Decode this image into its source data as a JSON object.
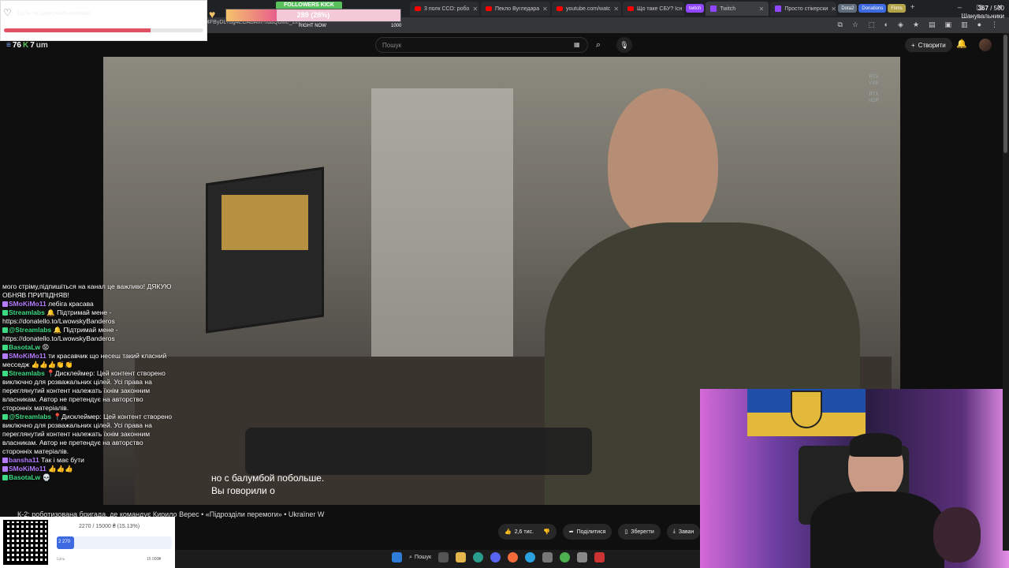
{
  "browser": {
    "url": "4FByDLTbg4ECABAIK-ndaQBMe_zx7",
    "tabs": [
      {
        "label": "3 полк ССО: робо",
        "icon": "youtube"
      },
      {
        "label": "Пекло Вугледара",
        "icon": "youtube"
      },
      {
        "label": "youtube.com/watc",
        "icon": "youtube"
      },
      {
        "label": "Що таке СБУ? Існ",
        "icon": "youtube"
      },
      {
        "label": "Twitch",
        "icon": "twitch"
      },
      {
        "label": "Просто стікерски",
        "icon": "twitch"
      }
    ],
    "twitch_chip": "twitch",
    "bookmark_chips": [
      "Dota2",
      "Donations",
      "Films"
    ],
    "window_controls": [
      "–",
      "▢",
      "✕"
    ]
  },
  "overlay_stats": {
    "left_value": "76",
    "mid_value": "7",
    "suffix": "um"
  },
  "goal": {
    "title": "Ціль за шанувальниками",
    "current": "367",
    "target": "500",
    "unit": "Шанувальники",
    "progress": 0.734
  },
  "followers_kick": {
    "label": "FOLLOWERS KICK",
    "value_text": "289 (28%)",
    "progress": 0.289,
    "right_label": "RIGHT NOW",
    "max": "1000"
  },
  "youtube": {
    "search_placeholder": "Пошук",
    "create_label": "Створити",
    "video_title": "К-2: роботизована бригада, де командує Кирило Верес • «Підрозділи перемоги» • Ukraїner W",
    "subtitles": [
      "но с балумбой побольше.",
      "Вы говорили о"
    ],
    "rtx_badges": [
      "RTX",
      "VSR",
      "RTX",
      "HDR"
    ],
    "actions": {
      "like_count": "2,6 тис.",
      "share": "Поділитися",
      "save": "Зберегти",
      "download": "Заван"
    }
  },
  "chat": [
    {
      "name": "",
      "text": "мого стріму,підпишіться на канал це важливо! ДЯКУЮ ОБНЯВ ПРИПІДНЯВ!",
      "color": "#ffffff"
    },
    {
      "name": "SMoKiMo11",
      "text": "лебіга красава",
      "color": "#b57cff"
    },
    {
      "name": "Streamlabs",
      "text": "🔔 Підтримай мене - https://donatello.to/LwowskyBanderos",
      "color": "#3ddc84"
    },
    {
      "name": "@Streamlabs",
      "text": "🔔 Підтримай мене - https://donatello.to/LwowskyBanderos",
      "color": "#3ddc84"
    },
    {
      "name": "BasotaLw",
      "text": "😡",
      "color": "#3ddc84"
    },
    {
      "name": "SMoKiMo11",
      "text": "ти красавчик що несеш такий класний месседж 👍👍👍👏👏",
      "color": "#b57cff"
    },
    {
      "name": "Streamlabs",
      "text": "📍Дисклеймер: Цей контент створено виключно для розважальних цілей. Усі права на переглянутий контент належать їхнім законним власникам. Автор не претендує на авторство сторонніх матеріалів.",
      "color": "#3ddc84"
    },
    {
      "name": "@Streamlabs",
      "text": "📍Дисклеймер: Цей контент створено виключно для розважальних цілей. Усі права на переглянутий контент належать їхнім законним власникам. Автор не претендує на авторство сторонніх матеріалів.",
      "color": "#3ddc84"
    },
    {
      "name": "bansha11",
      "text": "Так і має бути",
      "color": "#b57cff"
    },
    {
      "name": "SMoKiMo11",
      "text": "👍👍👍",
      "color": "#b57cff"
    },
    {
      "name": "BasotaLw",
      "text": "💀",
      "color": "#3ddc84"
    }
  ],
  "donation": {
    "summary": "2270 / 15000 ₴ (15.13%)",
    "bar_label": "2 270",
    "progress": 0.1513,
    "left_label": "Ціль",
    "right_label": "15 000₴"
  },
  "taskbar": {
    "search_label": "Пошук"
  }
}
